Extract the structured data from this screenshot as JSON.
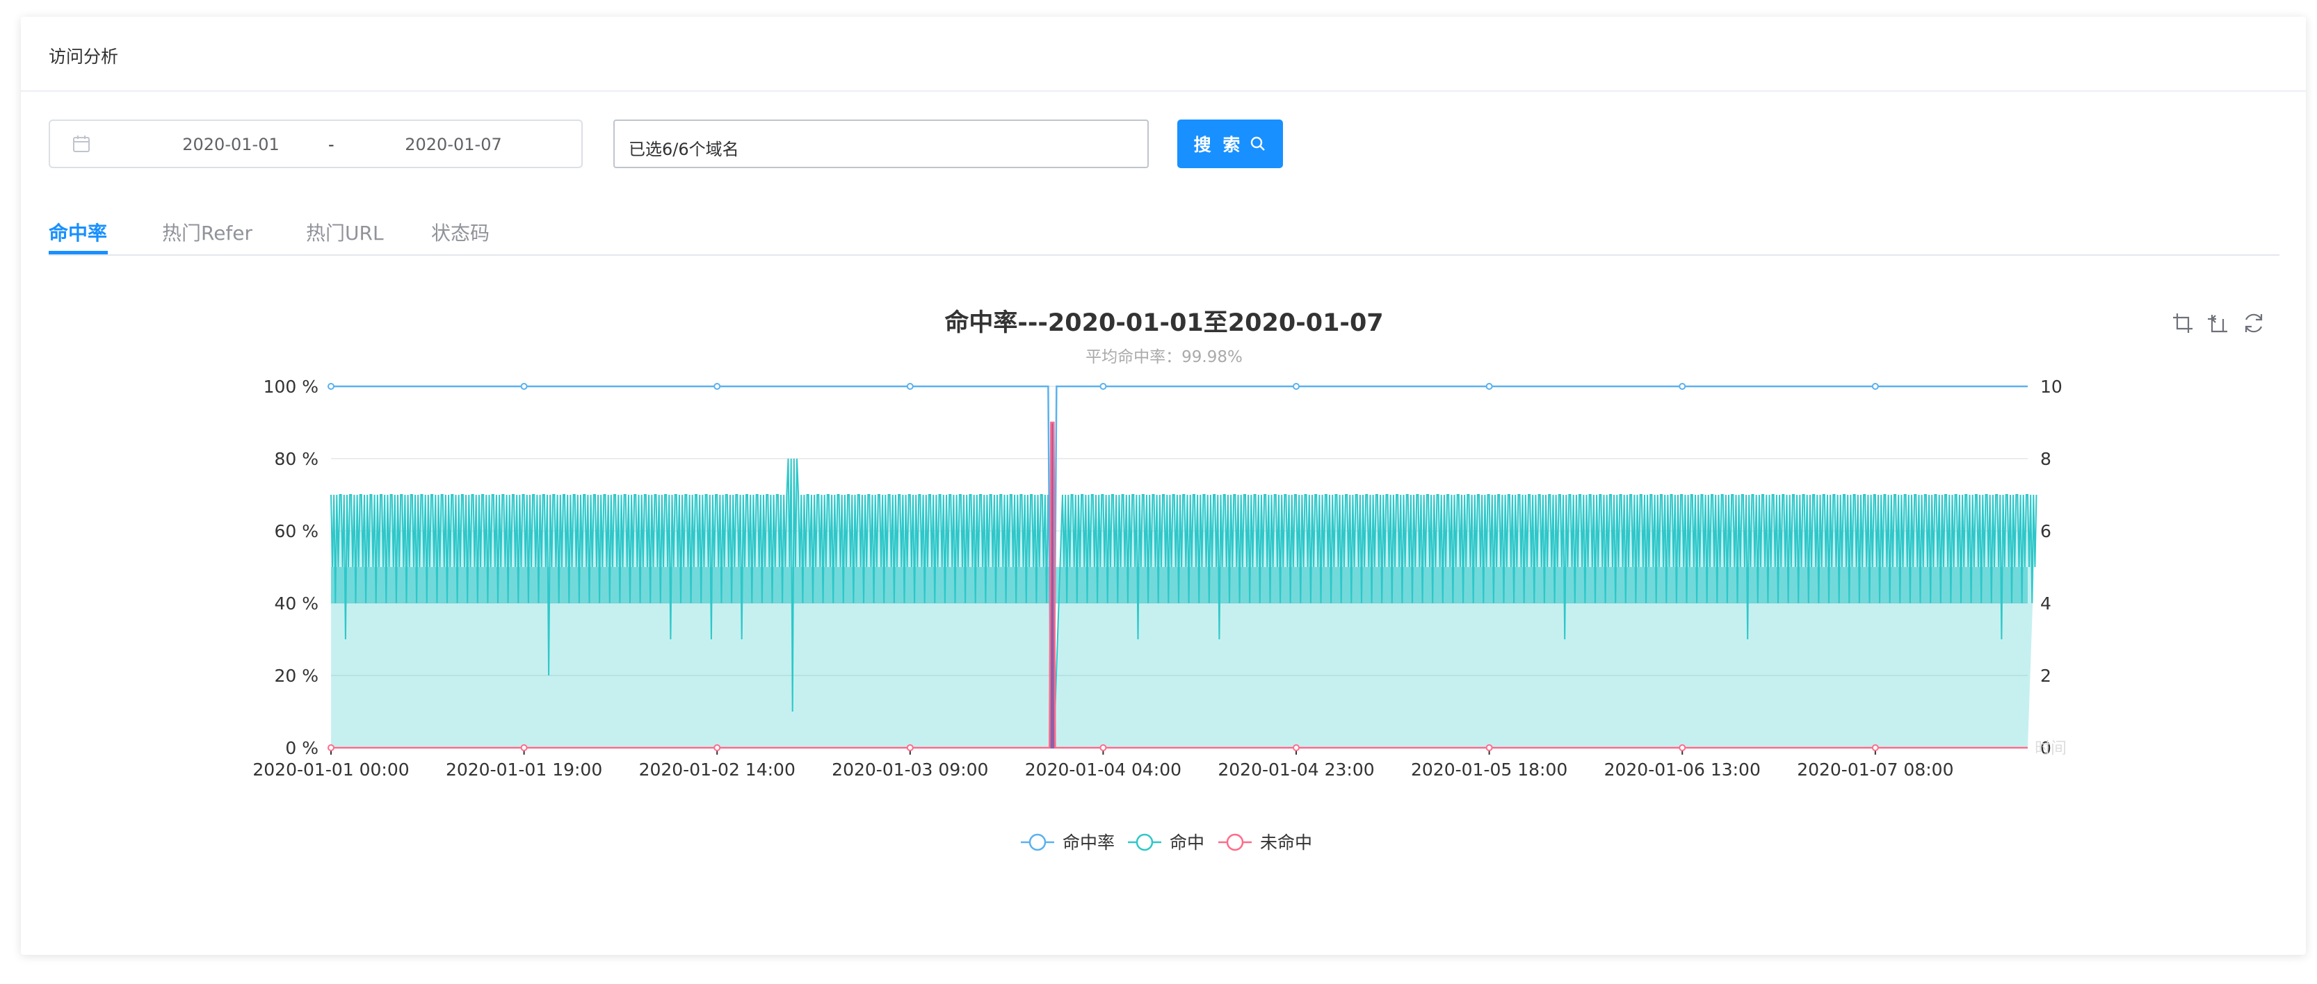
{
  "header": {
    "title": "访问分析"
  },
  "filters": {
    "date_start": "2020-01-01",
    "date_sep": "-",
    "date_end": "2020-01-07",
    "domain_value": "已选6/6个域名",
    "search_label": "搜 索"
  },
  "tabs": [
    {
      "label": "命中率",
      "active": true
    },
    {
      "label": "热门Refer",
      "active": false
    },
    {
      "label": "热门URL",
      "active": false
    },
    {
      "label": "状态码",
      "active": false
    }
  ],
  "toolbox": {
    "icons": [
      "crop-zoom-icon",
      "zoom-reset-icon",
      "restore-icon"
    ]
  },
  "colors": {
    "accent": "#1890ff",
    "hit_rate_line": "#5ab1ef",
    "hit_series": "#2ec7c9",
    "miss_series": "#ff6b8a",
    "spike": "#8b5fa8"
  },
  "chart_data": {
    "type": "line",
    "title": "命中率---2020-01-01至2020-01-07",
    "subtitle": "平均命中率：99.98%",
    "xlabel": "时间",
    "x_tick_labels": [
      "2020-01-01 00:00",
      "2020-01-01 19:00",
      "2020-01-02 14:00",
      "2020-01-03 09:00",
      "2020-01-04 04:00",
      "2020-01-04 23:00",
      "2020-01-05 18:00",
      "2020-01-06 13:00",
      "2020-01-07 08:00"
    ],
    "x_range": [
      "2020-01-01 00:00",
      "2020-01-07 23:00"
    ],
    "y_left": {
      "ylim": [
        0,
        100
      ],
      "ticks": [
        "0 %",
        "20 %",
        "40 %",
        "60 %",
        "80 %",
        "100 %"
      ]
    },
    "y_right": {
      "ylim": [
        0,
        10
      ],
      "ticks": [
        "0",
        "2",
        "4",
        "6",
        "8",
        "10"
      ]
    },
    "grid": true,
    "legend_position": "bottom",
    "series": [
      {
        "name": "命中率",
        "axis": "left",
        "unit": "%",
        "baseline": 100,
        "dips": [
          {
            "x": "2020-01-03 23:00",
            "value": 0
          }
        ]
      },
      {
        "name": "命中",
        "axis": "right",
        "area": true,
        "typical_band": [
          4,
          7
        ],
        "dips": [
          {
            "x": "2020-01-01 01:00",
            "value": 3
          },
          {
            "x": "2020-01-01 21:00",
            "value": 2
          },
          {
            "x": "2020-01-02 09:00",
            "value": 3
          },
          {
            "x": "2020-01-02 13:00",
            "value": 3
          },
          {
            "x": "2020-01-02 16:00",
            "value": 3
          },
          {
            "x": "2020-01-04 07:00",
            "value": 3
          },
          {
            "x": "2020-01-04 15:00",
            "value": 3
          },
          {
            "x": "2020-01-06 01:00",
            "value": 3
          },
          {
            "x": "2020-01-06 19:00",
            "value": 3
          },
          {
            "x": "2020-01-07 20:00",
            "value": 3
          }
        ],
        "peaks": [
          {
            "x": "2020-01-02 21:00",
            "value": 8
          }
        ],
        "deep_dips": [
          {
            "x": "2020-01-02 21:00",
            "value": 1
          }
        ]
      },
      {
        "name": "未命中",
        "axis": "right",
        "baseline": 0,
        "spikes": [
          {
            "x": "2020-01-03 23:00",
            "value": 9
          }
        ]
      }
    ]
  }
}
